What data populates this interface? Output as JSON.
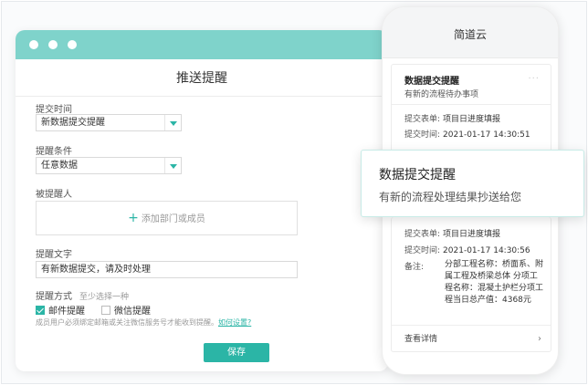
{
  "window": {
    "title": "推送提醒"
  },
  "form": {
    "submit_time_label": "提交时间",
    "submit_time_value": "新数据提交提醒",
    "condition_label": "提醒条件",
    "condition_value": "任意数据",
    "recipient_label": "被提醒人",
    "add_recipient_text": "添加部门或成员",
    "message_label": "提醒文字",
    "message_value": "有新数据提交，请及时处理",
    "method_label": "提醒方式",
    "method_hint": "至少选择一种",
    "email_option": "邮件提醒",
    "wechat_option": "微信提醒",
    "note_text": "成员用户必须绑定邮箱或关注微信服务号才能收到提醒。",
    "note_link": "如何设置?",
    "save_label": "保存"
  },
  "phone": {
    "app_title": "简道云",
    "card1": {
      "title": "数据提交提醒",
      "subtitle": "有新的流程待办事项",
      "more": "···",
      "form_key": "提交表单:",
      "form_value": "项目日进度填报",
      "time_key": "提交时间:",
      "time_value": "2021-01-17 14:30:51"
    },
    "card2": {
      "form_key": "提交表单:",
      "form_value": "项目日进度填报",
      "time_key": "提交时间:",
      "time_value": "2021-01-17 14:30:56",
      "note_key": "备注:",
      "note_value": "分部工程名称：桥面系、附属工程及桥梁总体 分项工程名称：混凝土护栏分项工程当日总产值：4368元",
      "detail_label": "查看详情"
    }
  },
  "popup": {
    "title": "数据提交提醒",
    "subtitle": "有新的流程处理结果抄送给您"
  },
  "colors": {
    "accent": "#2bb5a6",
    "titlebar": "#7fd3cb"
  }
}
